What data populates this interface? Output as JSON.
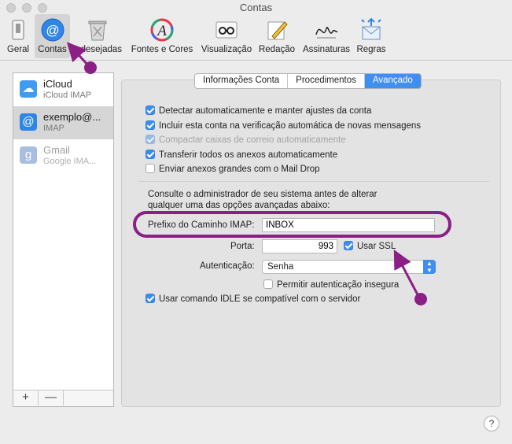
{
  "window": {
    "title": "Contas"
  },
  "toolbar": {
    "items": [
      {
        "label": "Geral",
        "icon": "switch-icon"
      },
      {
        "label": "Contas",
        "icon": "at-sign-icon",
        "active": true
      },
      {
        "label": "Indesejadas",
        "icon": "trash-icon"
      },
      {
        "label": "Fontes e Cores",
        "icon": "fonts-colors-icon"
      },
      {
        "label": "Visualização",
        "icon": "glasses-icon"
      },
      {
        "label": "Redação",
        "icon": "compose-icon"
      },
      {
        "label": "Assinaturas",
        "icon": "signature-icon"
      },
      {
        "label": "Regras",
        "icon": "rules-icon"
      }
    ]
  },
  "accounts": {
    "items": [
      {
        "name": "iCloud",
        "type": "iCloud IMAP"
      },
      {
        "name": "exemplo@...",
        "type": "IMAP",
        "selected": true
      },
      {
        "name": "Gmail",
        "type": "Google IMA...",
        "disabled": true
      }
    ],
    "add_label": "+",
    "remove_label": "—"
  },
  "tabs": [
    {
      "label": "Informações Conta"
    },
    {
      "label": "Procedimentos"
    },
    {
      "label": "Avançado",
      "active": true
    }
  ],
  "options": {
    "auto_detect": {
      "label": "Detectar automaticamente e manter ajustes da conta",
      "checked": true
    },
    "include_in_check": {
      "label": "Incluir esta conta na verificação automática de novas mensagens",
      "checked": true
    },
    "compact_mailboxes": {
      "label": "Compactar caixas de correio automaticamente",
      "checked": true,
      "disabled": true
    },
    "download_attachments": {
      "label": "Transferir todos os anexos automaticamente",
      "checked": true
    },
    "mail_drop": {
      "label": "Enviar anexos grandes com o Mail Drop",
      "checked": false
    }
  },
  "advanced": {
    "note": "Consulte o administrador de seu sistema antes de alterar qualquer uma das opções avançadas abaixo:",
    "imap_prefix_label": "Prefixo do Caminho IMAP:",
    "imap_prefix_value": "INBOX",
    "port_label": "Porta:",
    "port_value": "993",
    "ssl_label": "Usar SSL",
    "ssl_checked": true,
    "auth_label": "Autenticação:",
    "auth_value": "Senha",
    "insecure_label": "Permitir autenticação insegura",
    "insecure_checked": false,
    "idle_label": "Usar comando IDLE se compatível com o servidor",
    "idle_checked": true
  },
  "help_label": "?",
  "colors": {
    "accent": "#3f8ff0",
    "annotation": "#8b1f86"
  }
}
